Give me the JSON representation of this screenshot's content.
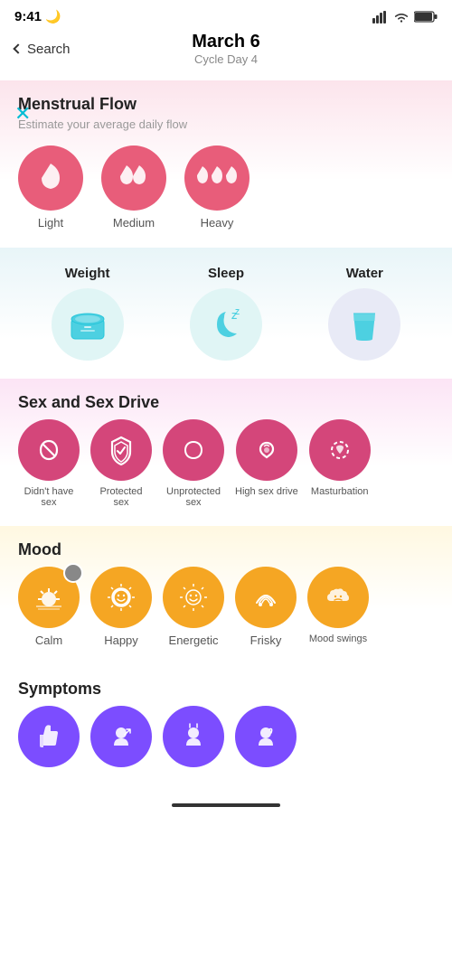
{
  "status": {
    "time": "9:41",
    "moon": "🌙"
  },
  "nav": {
    "back_label": "Search",
    "title": "March 6",
    "subtitle": "Cycle Day 4",
    "close_symbol": "✕"
  },
  "menstrual": {
    "title": "Menstrual Flow",
    "subtitle": "Estimate your average daily flow",
    "items": [
      {
        "label": "Light",
        "drops": 1
      },
      {
        "label": "Medium",
        "drops": 2
      },
      {
        "label": "Heavy",
        "drops": 3
      }
    ]
  },
  "health": {
    "items": [
      {
        "key": "weight",
        "label": "Weight"
      },
      {
        "key": "sleep",
        "label": "Sleep"
      },
      {
        "key": "water",
        "label": "Water"
      }
    ]
  },
  "sex": {
    "title": "Sex and Sex Drive",
    "items": [
      {
        "label": "Didn't have sex"
      },
      {
        "label": "Protected sex"
      },
      {
        "label": "Unprotected sex"
      },
      {
        "label": "High sex drive"
      },
      {
        "label": "Masturbation"
      }
    ]
  },
  "mood": {
    "title": "Mood",
    "items": [
      {
        "label": "Calm",
        "selected": true
      },
      {
        "label": "Happy"
      },
      {
        "label": "Energetic"
      },
      {
        "label": "Frisky"
      },
      {
        "label": "Mood swings"
      }
    ]
  },
  "symptoms": {
    "title": "Symptoms"
  }
}
